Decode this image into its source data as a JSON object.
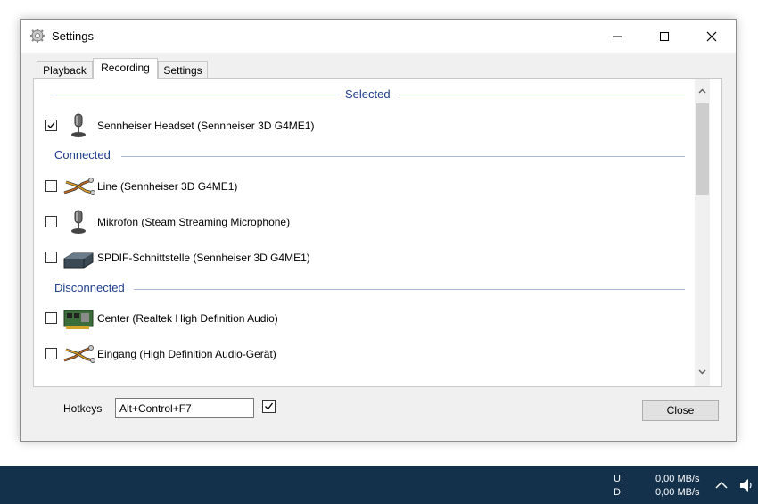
{
  "window": {
    "title": "Settings",
    "controls": {
      "minimize": "minimize",
      "maximize": "maximize",
      "close": "close"
    }
  },
  "tabs": [
    {
      "label": "Playback",
      "active": false
    },
    {
      "label": "Recording",
      "active": true
    },
    {
      "label": "Settings",
      "active": false
    }
  ],
  "groups": {
    "selected": "Selected",
    "connected": "Connected",
    "disconnected": "Disconnected"
  },
  "devices": [
    {
      "label": "Sennheiser Headset (Sennheiser 3D G4ME1)",
      "checked": true,
      "icon": "microphone-icon"
    },
    {
      "label": "Line (Sennheiser 3D G4ME1)",
      "checked": false,
      "icon": "audio-cable-icon"
    },
    {
      "label": "Mikrofon (Steam Streaming Microphone)",
      "checked": false,
      "icon": "microphone-icon"
    },
    {
      "label": "SPDIF-Schnittstelle (Sennheiser 3D G4ME1)",
      "checked": false,
      "icon": "spdif-device-icon"
    },
    {
      "label": "Center (Realtek High Definition Audio)",
      "checked": false,
      "icon": "sound-card-icon"
    },
    {
      "label": "Eingang (High Definition Audio-Gerät)",
      "checked": false,
      "icon": "audio-cable-icon"
    }
  ],
  "footer": {
    "hotkeys_label": "Hotkeys",
    "hotkeys_value": "Alt+Control+F7",
    "hotkeys_enabled": true,
    "close_label": "Close"
  },
  "taskbar": {
    "upload_label": "U:",
    "download_label": "D:",
    "upload_value": "0,00 MB/s",
    "download_value": "0,00 MB/s"
  },
  "colors": {
    "group_header": "#1e3d8c",
    "taskbar": "#14314c"
  }
}
